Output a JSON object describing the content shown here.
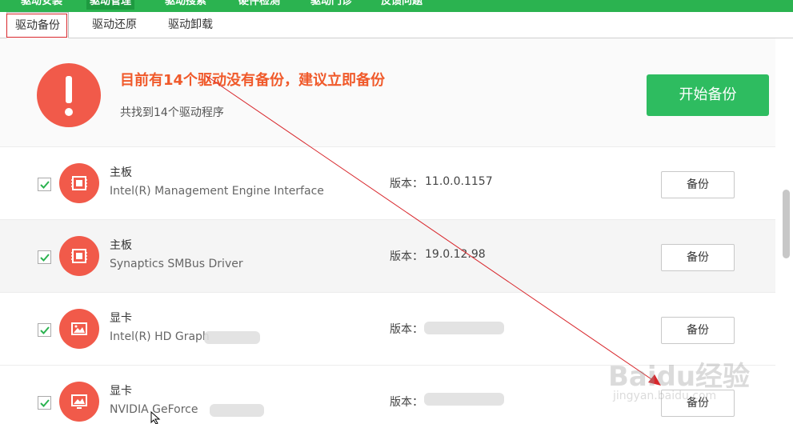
{
  "top_nav": {
    "tabs": [
      {
        "label": "驱动安装"
      },
      {
        "label": "驱动管理"
      },
      {
        "label": "驱动搜索"
      },
      {
        "label": "硬件检测"
      },
      {
        "label": "驱动门诊"
      },
      {
        "label": "反馈问题"
      }
    ]
  },
  "sub_nav": {
    "tabs": [
      {
        "label": "驱动备份"
      },
      {
        "label": "驱动还原"
      },
      {
        "label": "驱动卸载"
      }
    ]
  },
  "summary": {
    "title": "目前有14个驱动没有备份，建议立即备份",
    "subtitle": "共找到14个驱动程序",
    "start_button": "开始备份"
  },
  "drivers": [
    {
      "category": "主板",
      "name": "Intel(R) Management Engine Interface",
      "version_label": "版本：",
      "version": "11.0.0.1157",
      "button": "备份",
      "checked": true
    },
    {
      "category": "主板",
      "name": "Synaptics SMBus Driver",
      "version_label": "版本：",
      "version": "19.0.12.98",
      "button": "备份",
      "checked": true
    },
    {
      "category": "显卡",
      "name": "Intel(R) HD Graph",
      "version_label": "版本：",
      "version": "",
      "button": "备份",
      "checked": true
    },
    {
      "category": "显卡",
      "name": "NVIDIA GeForce",
      "version_label": "版本：",
      "version": "",
      "button": "备份",
      "checked": true
    }
  ],
  "watermark": {
    "main": "Baidu经验",
    "url": "jingyan.baidu.com"
  },
  "colors": {
    "brand_green": "#2bb350",
    "alert_red": "#f15a4a",
    "alert_text": "#f05a2b",
    "annotation_red": "#d8262b"
  }
}
